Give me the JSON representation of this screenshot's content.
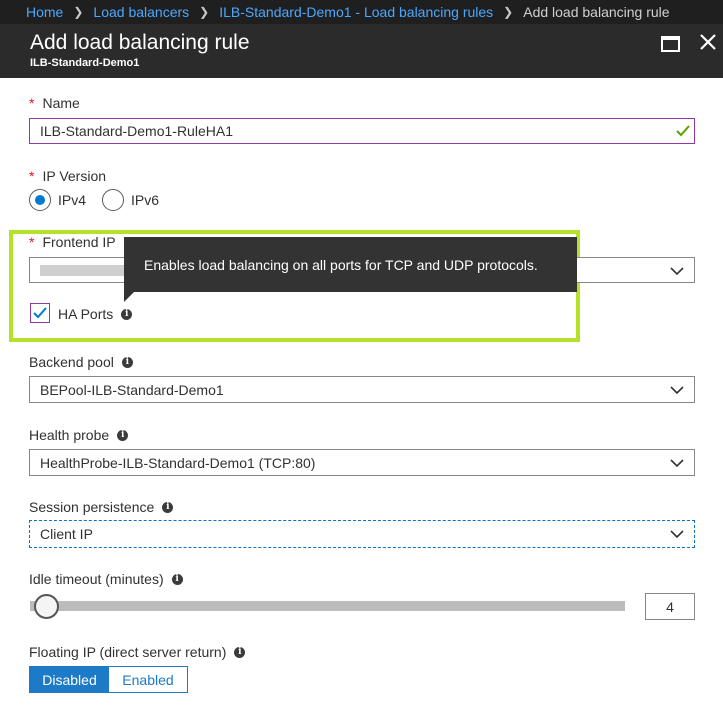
{
  "breadcrumb": {
    "items": [
      "Home",
      "Load balancers",
      "ILB-Standard-Demo1 - Load balancing rules"
    ],
    "current": "Add load balancing rule"
  },
  "blade": {
    "title": "Add load balancing rule",
    "subtitle": "ILB-Standard-Demo1"
  },
  "form": {
    "name": {
      "label": "Name",
      "value": "ILB-Standard-Demo1-RuleHA1"
    },
    "ip_version": {
      "label": "IP Version",
      "options": [
        "IPv4",
        "IPv6"
      ],
      "selected": "IPv4"
    },
    "frontend_ip": {
      "label": "Frontend IP"
    },
    "ha_ports": {
      "label": "HA Ports",
      "checked": true,
      "tooltip": "Enables load balancing on all ports for TCP and UDP protocols."
    },
    "backend_pool": {
      "label": "Backend pool",
      "value": "BEPool-ILB-Standard-Demo1"
    },
    "health_probe": {
      "label": "Health probe",
      "value": "HealthProbe-ILB-Standard-Demo1 (TCP:80)"
    },
    "session_persistence": {
      "label": "Session persistence",
      "value": "Client IP"
    },
    "idle_timeout": {
      "label": "Idle timeout (minutes)",
      "value": "4"
    },
    "floating_ip": {
      "label": "Floating IP (direct server return)",
      "options": [
        "Disabled",
        "Enabled"
      ],
      "selected": "Disabled"
    }
  },
  "colors": {
    "accent": "#0078d4",
    "highlight": "#b6e12a",
    "required": "#e81123",
    "link": "#4aa8ff"
  }
}
